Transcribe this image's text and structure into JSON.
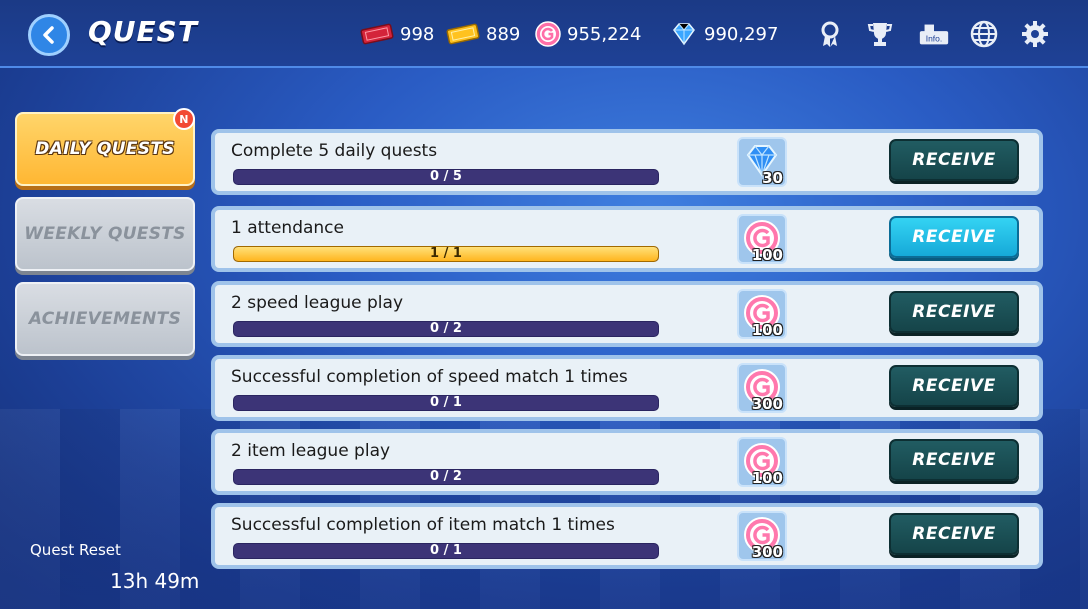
{
  "header": {
    "title": "QUEST",
    "currencies": [
      {
        "icon": "red-ticket-icon",
        "value": "998"
      },
      {
        "icon": "gold-ticket-icon",
        "value": "889"
      },
      {
        "icon": "pink-coin-icon",
        "value": "955,224"
      },
      {
        "icon": "diamond-icon",
        "value": "990,297"
      }
    ],
    "icons": [
      "medal-icon",
      "trophy-icon",
      "info-icon",
      "globe-icon",
      "gear-icon"
    ],
    "info_label": "Info."
  },
  "tabs": [
    {
      "label": "DAILY QUESTS",
      "active": true,
      "badge": "N"
    },
    {
      "label": "WEEKLY QUESTS",
      "active": false
    },
    {
      "label": "ACHIEVEMENTS",
      "active": false
    }
  ],
  "reset": {
    "label": "Quest Reset",
    "time": "13h 49m"
  },
  "quests": [
    {
      "title": "Complete 5 daily quests",
      "progress": "0 / 5",
      "fraction": 0,
      "reward_type": "diamond",
      "reward_amount": "30",
      "button": "RECEIVE",
      "ready": false
    },
    {
      "title": "1 attendance",
      "progress": "1 / 1",
      "fraction": 1,
      "reward_type": "coin",
      "reward_amount": "100",
      "button": "RECEIVE",
      "ready": true
    },
    {
      "title": "2 speed league play",
      "progress": "0 / 2",
      "fraction": 0,
      "reward_type": "coin",
      "reward_amount": "100",
      "button": "RECEIVE",
      "ready": false
    },
    {
      "title": "Successful completion of speed match 1 times",
      "progress": "0 / 1",
      "fraction": 0,
      "reward_type": "coin",
      "reward_amount": "300",
      "button": "RECEIVE",
      "ready": false
    },
    {
      "title": "2 item league play",
      "progress": "0 / 2",
      "fraction": 0,
      "reward_type": "coin",
      "reward_amount": "100",
      "button": "RECEIVE",
      "ready": false
    },
    {
      "title": "Successful completion of item match 1 times",
      "progress": "0 / 1",
      "fraction": 0,
      "reward_type": "coin",
      "reward_amount": "300",
      "button": "RECEIVE",
      "ready": false
    }
  ],
  "colors": {
    "accent": "#ffb733",
    "receive_ready": "#16a9d8",
    "receive_idle": "#154449",
    "bar": "#3c3477"
  }
}
